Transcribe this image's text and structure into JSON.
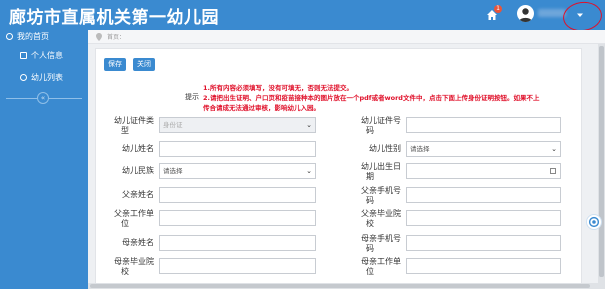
{
  "header": {
    "title": "廊坊市直属机关第一幼儿园",
    "badge_count": "1",
    "brand_color": "#3a8ad0"
  },
  "sidebar": {
    "items": [
      {
        "label": "我的首页",
        "icon": "home-circle-icon"
      },
      {
        "label": "个人信息",
        "icon": "grid-icon"
      },
      {
        "label": "幼儿列表",
        "icon": "settings-circle-icon"
      }
    ],
    "toggle": "«"
  },
  "breadcrumb": {
    "text": "首页："
  },
  "toolbar": {
    "save_label": "保存",
    "close_label": "关闭"
  },
  "tips": {
    "label": "提示",
    "line1": "1.所有内容必须填写，没有可填无，否则无法提交。",
    "line2": "2.请把出生证明、户口页和疫苗接种本的图片放在一个pdf或者word文件中，点击下面上传身份证明按钮。如果不上",
    "line3": "传合请成无法通过审核，影响幼儿入园。"
  },
  "form": {
    "left": [
      {
        "label_lines": [
          "幼儿证件类",
          "型"
        ],
        "value": "身份证",
        "kind": "select",
        "disabled": true
      },
      {
        "label_lines": [
          "幼儿姓名"
        ],
        "value": "",
        "kind": "text"
      },
      {
        "label_lines": [
          "幼儿民族"
        ],
        "value": "请选择",
        "kind": "select"
      },
      {
        "label_lines": [
          "父亲姓名"
        ],
        "value": "",
        "kind": "text"
      },
      {
        "label_lines": [
          "父亲工作单",
          "位"
        ],
        "value": "",
        "kind": "text"
      },
      {
        "label_lines": [
          "母亲姓名"
        ],
        "value": "",
        "kind": "text"
      },
      {
        "label_lines": [
          "母亲毕业院",
          "校"
        ],
        "value": "",
        "kind": "text"
      }
    ],
    "right": [
      {
        "label_lines": [
          "幼儿证件号",
          "码"
        ],
        "value": "",
        "kind": "text"
      },
      {
        "label_lines": [
          "幼儿性别"
        ],
        "value": "请选择",
        "kind": "select"
      },
      {
        "label_lines": [
          "幼儿出生日",
          "期"
        ],
        "value": "",
        "kind": "date"
      },
      {
        "label_lines": [
          "父亲手机号",
          "码"
        ],
        "value": "",
        "kind": "text"
      },
      {
        "label_lines": [
          "父亲毕业院",
          "校"
        ],
        "value": "",
        "kind": "text"
      },
      {
        "label_lines": [
          "母亲手机号",
          "码"
        ],
        "value": "",
        "kind": "text"
      },
      {
        "label_lines": [
          "母亲工作单",
          "位"
        ],
        "value": "",
        "kind": "text"
      }
    ]
  }
}
